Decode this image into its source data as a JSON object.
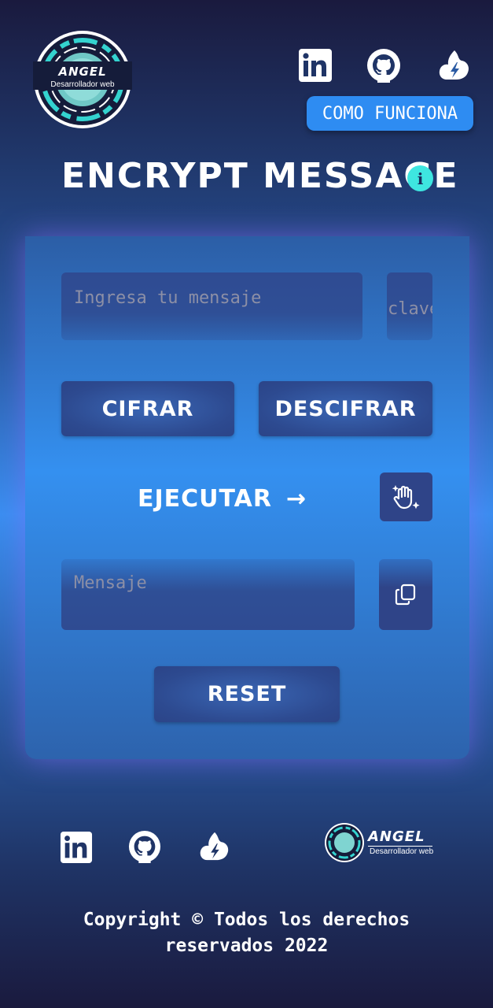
{
  "brand": {
    "name": "ANGEL",
    "tagline": "Desarrollador web"
  },
  "header": {
    "social": [
      {
        "icon": "linkedin-icon"
      },
      {
        "icon": "github-icon"
      },
      {
        "icon": "platzi-icon"
      }
    ],
    "how_it_works_label": "COMO FUNCIONA",
    "title": "ENCRYPT MESSAGE",
    "info_icon": "info-icon",
    "info_glyph": "i"
  },
  "form": {
    "message_placeholder": "Ingresa tu mensaje",
    "key_placeholder": "clave",
    "encrypt_label": "CIFRAR",
    "decrypt_label": "DESCIFRAR",
    "run_label": "EJECUTAR",
    "run_arrow": "→",
    "magic_icon": "magic-hand-icon",
    "output_placeholder": "Mensaje",
    "copy_icon": "copy-icon",
    "reset_label": "RESET"
  },
  "footer": {
    "social": [
      {
        "icon": "linkedin-icon"
      },
      {
        "icon": "github-icon"
      },
      {
        "icon": "platzi-icon"
      }
    ],
    "copyright_line1": "Copyright © Todos los derechos",
    "copyright_line2": "reservados 2022"
  },
  "colors": {
    "accent": "#2e8cf2",
    "info": "#3ee6e0",
    "button": "#2d4a90",
    "card_glow": "#8c6eff"
  }
}
